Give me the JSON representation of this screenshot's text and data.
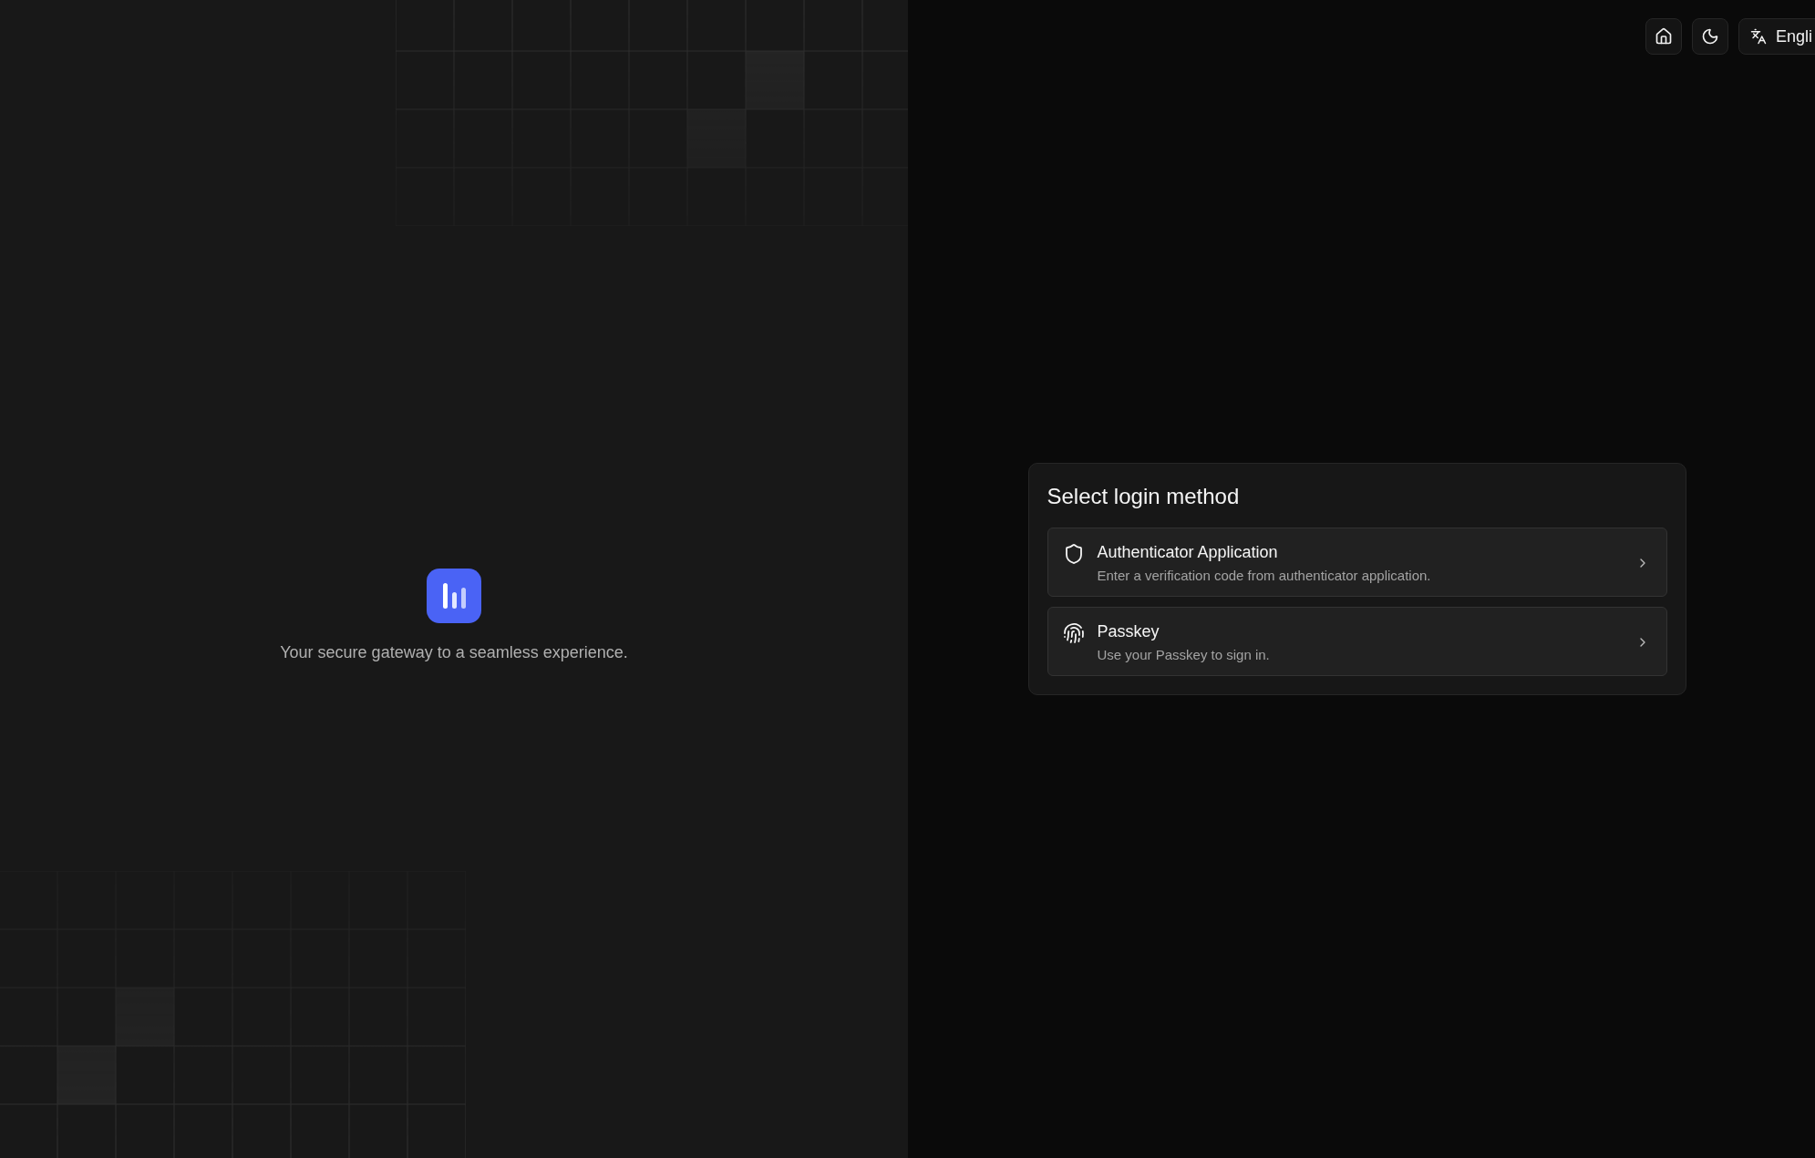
{
  "header": {
    "buttons": [
      {
        "kind": "home"
      },
      {
        "kind": "theme"
      },
      {
        "kind": "language",
        "label": "Engli"
      }
    ]
  },
  "brand": {
    "tagline": "Your secure gateway to a seamless experience."
  },
  "login": {
    "title": "Select login method",
    "methods": [
      {
        "kind": "authenticator",
        "title": "Authenticator Application",
        "description": "Enter a verification code from authenticator application."
      },
      {
        "kind": "passkey",
        "title": "Passkey",
        "description": "Use your Passkey to sign in."
      }
    ]
  }
}
